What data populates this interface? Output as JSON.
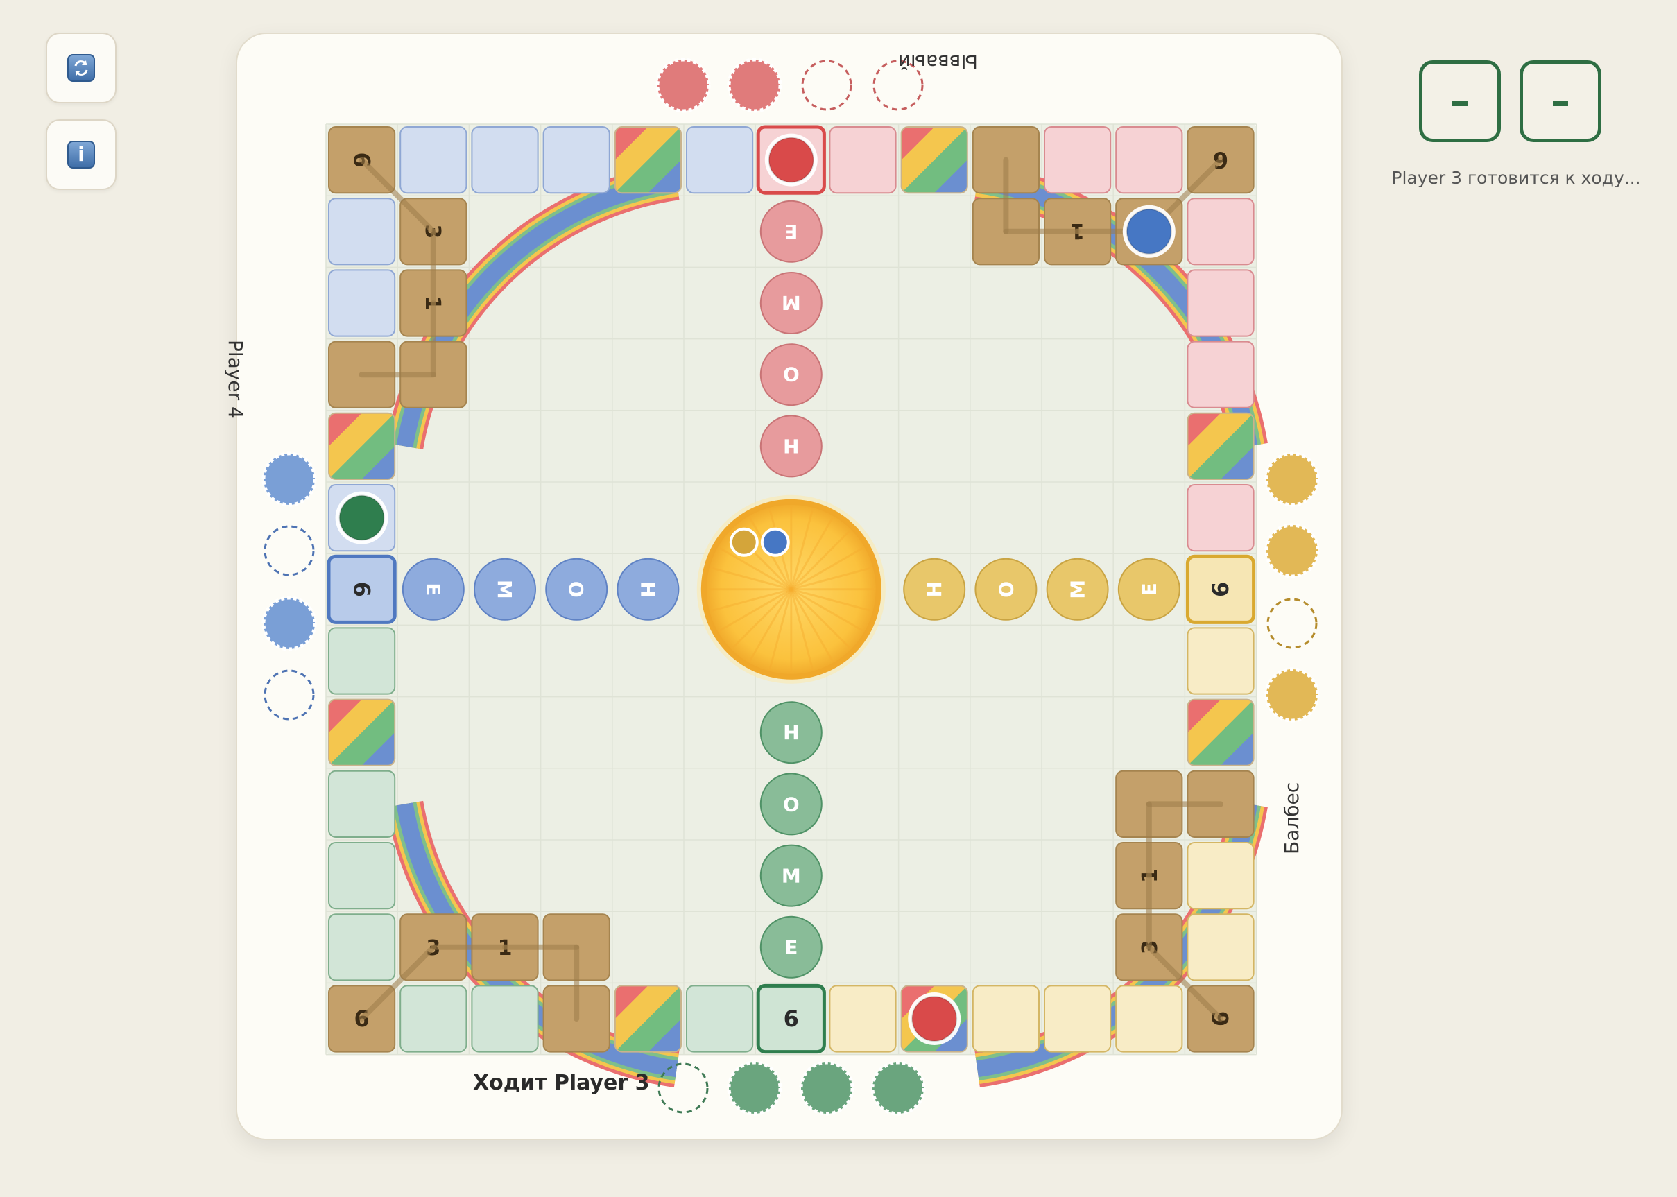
{
  "toolbar": {
    "refresh_icon": "refresh-icon",
    "info_icon": "info-icon",
    "info_glyph": "i"
  },
  "scores": [
    "–",
    "–"
  ],
  "status_text": "Player 3 готовится к ходу...",
  "turn_prefix": "Ходит",
  "players": {
    "top": {
      "name": "Ывваый",
      "color": "#e07b7b",
      "reserve": [
        true,
        true,
        false,
        false
      ]
    },
    "left": {
      "name": "Player 4",
      "color": "#7a9fd6",
      "reserve": [
        true,
        false,
        true,
        false
      ]
    },
    "right": {
      "name": "Балбес",
      "color": "#e2b856",
      "reserve": [
        true,
        true,
        false,
        true
      ]
    },
    "bottom": {
      "name": "Player 3",
      "color": "#6aa57e",
      "reserve": [
        false,
        true,
        true,
        true
      ]
    }
  },
  "home_word": [
    "Н",
    "О",
    "М",
    "Е"
  ],
  "corner_label": "6",
  "path_numbers": [
    "3",
    "1"
  ],
  "start_label": "6",
  "colors": {
    "red": "#d94a4a",
    "blue": "#4677c4",
    "green": "#2f7e4e",
    "yellow": "#d4a53a",
    "brown": "#c4a06a",
    "center": "#f8b93a"
  }
}
